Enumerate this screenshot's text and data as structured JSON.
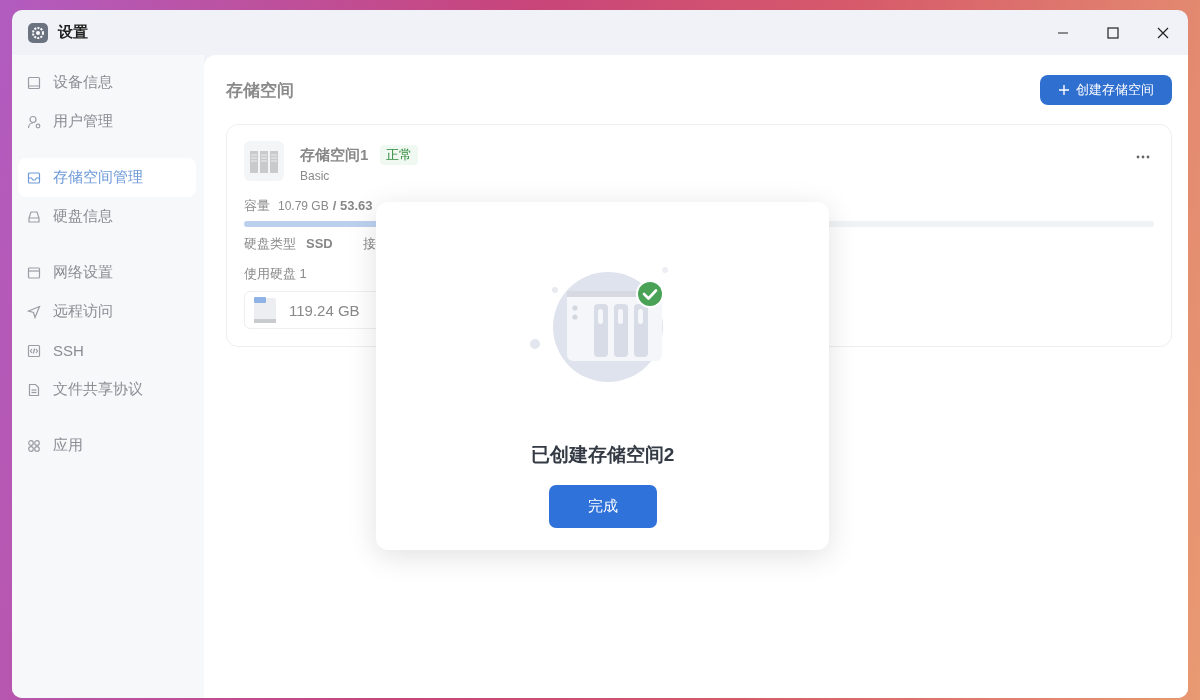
{
  "window": {
    "title": "设置"
  },
  "sidebar": {
    "groups": [
      {
        "items": [
          {
            "label": "设备信息",
            "selected": false
          },
          {
            "label": "用户管理",
            "selected": false
          }
        ]
      },
      {
        "items": [
          {
            "label": "存储空间管理",
            "selected": true
          },
          {
            "label": "硬盘信息",
            "selected": false
          }
        ]
      },
      {
        "items": [
          {
            "label": "网络设置",
            "selected": false
          },
          {
            "label": "远程访问",
            "selected": false
          },
          {
            "label": "SSH",
            "selected": false
          },
          {
            "label": "文件共享协议",
            "selected": false
          }
        ]
      },
      {
        "items": [
          {
            "label": "应用",
            "selected": false
          }
        ]
      }
    ]
  },
  "page": {
    "title": "存储空间",
    "create_button": "创建存储空间"
  },
  "pools": [
    {
      "name": "存储空间1",
      "status": "正常",
      "type": "Basic",
      "capacity_label": "容量",
      "used": "10.79 GB",
      "total": "/ 53.63",
      "level": 0.2,
      "disk_type_label": "硬盘类型",
      "disk_type": "SSD",
      "interface_label": "接",
      "disks_label": "使用硬盘 1",
      "disks": [
        {
          "size": "119.24 GB"
        }
      ]
    }
  ],
  "dialog": {
    "message": "已创建存储空间2",
    "button": "完成"
  }
}
